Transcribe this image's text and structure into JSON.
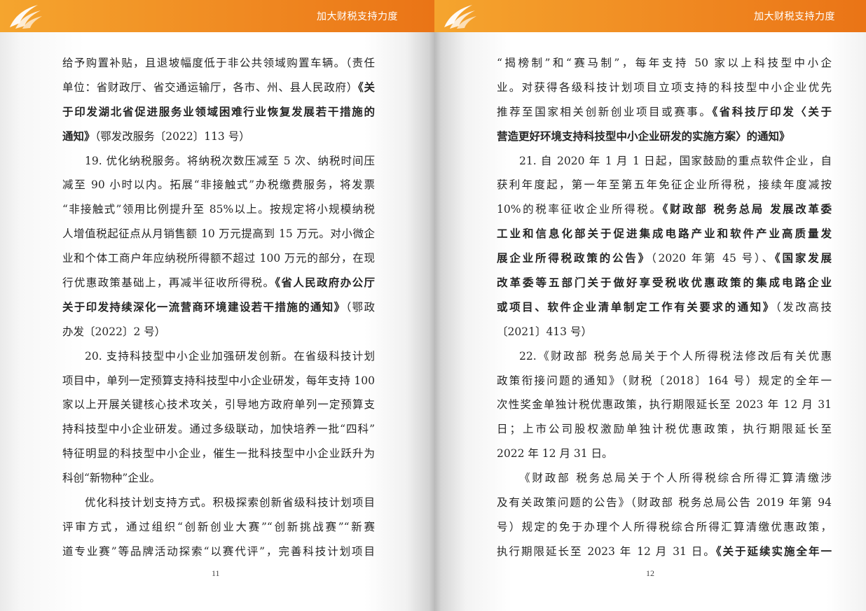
{
  "header": {
    "title": "加大财税支持力度"
  },
  "icons": {
    "logo": "stylized-wing-logo-icon"
  },
  "colors": {
    "band_start": "#f5a52e",
    "band_end": "#ea7416",
    "text": "#262626"
  },
  "left_page": {
    "page_number": "11",
    "lines": [
      {
        "segs": [
          {
            "t": "给予购置补贴，且退坡幅度低于非公共领域购置车辆。（责任"
          }
        ]
      },
      {
        "segs": [
          {
            "t": "单位：省财政厅、省交通运输厅，各市、州、县人民政府）"
          },
          {
            "t": "《关",
            "b": true
          }
        ]
      },
      {
        "segs": [
          {
            "t": "于印发湖北省促进服务业领域困难行业恢复发展若干措施的",
            "b": true
          }
        ]
      },
      {
        "last": true,
        "segs": [
          {
            "t": "通知》",
            "b": true
          },
          {
            "t": "（鄂发改服务〔2022〕113 号）"
          }
        ]
      },
      {
        "ind": true,
        "segs": [
          {
            "t": "19. 优化纳税服务。将纳税次数压减至 5 次、纳税时间压"
          }
        ]
      },
      {
        "segs": [
          {
            "t": "减至 90 小时以内。拓展“非接触式”办税缴费服务，将发票"
          }
        ]
      },
      {
        "segs": [
          {
            "t": "“非接触式”领用比例提升至 85%以上。按规定将小规模纳税"
          }
        ]
      },
      {
        "segs": [
          {
            "t": "人增值税起征点从月销售额 10 万元提高到 15 万元。对小微企"
          }
        ]
      },
      {
        "segs": [
          {
            "t": "业和个体工商户年应纳税所得额不超过 100 万元的部分，在现"
          }
        ]
      },
      {
        "segs": [
          {
            "t": "行优惠政策基础上，再减半征收所得税。"
          },
          {
            "t": "《省人民政府办公厅",
            "b": true
          }
        ]
      },
      {
        "segs": [
          {
            "t": "关于印发持续深化一流营商环境建设若干措施的通知》",
            "b": true
          },
          {
            "t": "（鄂政"
          }
        ]
      },
      {
        "last": true,
        "segs": [
          {
            "t": "办发〔2022〕2 号）"
          }
        ]
      },
      {
        "ind": true,
        "segs": [
          {
            "t": "20. 支持科技型中小企业加强研发创新。在省级科技计划"
          }
        ]
      },
      {
        "segs": [
          {
            "t": "项目中，单列一定预算支持科技型中小企业研发，每年支持 100"
          }
        ]
      },
      {
        "segs": [
          {
            "t": "家以上开展关键核心技术攻关，引导地方政府单列一定预算支"
          }
        ]
      },
      {
        "segs": [
          {
            "t": "持科技型中小企业研发。通过多级联动，加快培养一批“四科”"
          }
        ]
      },
      {
        "segs": [
          {
            "t": "特征明显的科技型中小企业，催生一批科技型中小企业跃升为"
          }
        ]
      },
      {
        "last": true,
        "segs": [
          {
            "t": "科创“新物种”企业。"
          }
        ]
      },
      {
        "ind": true,
        "segs": [
          {
            "t": "优化科技计划支持方式。积极探索创新省级科技计划项目"
          }
        ]
      },
      {
        "segs": [
          {
            "t": "评审方式，通过组织“创新创业大赛”“创新挑战赛”“新赛"
          }
        ]
      },
      {
        "segs": [
          {
            "t": "道专业赛”等品牌活动探索“以赛代评”，完善科技计划项目"
          }
        ]
      }
    ]
  },
  "right_page": {
    "page_number": "12",
    "lines": [
      {
        "segs": [
          {
            "t": "“揭榜制”和“赛马制”，每年支持 50 家以上科技型中小企"
          }
        ]
      },
      {
        "segs": [
          {
            "t": "业。对获得各级科技计划项目立项支持的科技型中小企业优先"
          }
        ]
      },
      {
        "segs": [
          {
            "t": "推荐至国家相关创新创业项目或赛事。"
          },
          {
            "t": "《省科技厅印发〈关于",
            "b": true
          }
        ]
      },
      {
        "last": true,
        "segs": [
          {
            "t": "营造更好环境支持科技型中小企业研发的实施方案〉的通知》",
            "b": true
          }
        ]
      },
      {
        "ind": true,
        "segs": [
          {
            "t": "21. 自 2020 年 1 月 1 日起，国家鼓励的重点软件企业，自"
          }
        ]
      },
      {
        "segs": [
          {
            "t": "获利年度起，第一年至第五年免征企业所得税，接续年度减按"
          }
        ]
      },
      {
        "segs": [
          {
            "t": "10%的税率征收企业所得税。"
          },
          {
            "t": "《财政部 税务总局 发展改革委",
            "b": true
          }
        ]
      },
      {
        "segs": [
          {
            "t": "工业和信息化部关于促进集成电路产业和软件产业高质量发",
            "b": true
          }
        ]
      },
      {
        "segs": [
          {
            "t": "展企业所得税政策的公告》",
            "b": true
          },
          {
            "t": "（2020 年第 45 号）、"
          },
          {
            "t": "《国家发展",
            "b": true
          }
        ]
      },
      {
        "segs": [
          {
            "t": "改革委等五部门关于做好享受税收优惠政策的集成电路企业",
            "b": true
          }
        ]
      },
      {
        "segs": [
          {
            "t": "或项目、软件企业清单制定工作有关要求的通知》",
            "b": true
          },
          {
            "t": "（发改高技"
          }
        ]
      },
      {
        "last": true,
        "segs": [
          {
            "t": "〔2021〕413 号）"
          }
        ]
      },
      {
        "ind": true,
        "segs": [
          {
            "t": "22.《财政部 税务总局关于个人所得税法修改后有关优惠"
          }
        ]
      },
      {
        "segs": [
          {
            "t": "政策衔接问题的通知》（财税〔2018〕164 号）规定的全年一"
          }
        ]
      },
      {
        "segs": [
          {
            "t": "次性奖金单独计税优惠政策，执行期限延长至 2023 年 12 月 31"
          }
        ]
      },
      {
        "segs": [
          {
            "t": "日；上市公司股权激励单独计税优惠政策，执行期限延长至"
          }
        ]
      },
      {
        "last": true,
        "segs": [
          {
            "t": "2022 年 12 月 31 日。"
          }
        ]
      },
      {
        "ind": true,
        "segs": [
          {
            "t": "《财政部 税务总局关于个人所得税综合所得汇算清缴涉"
          }
        ]
      },
      {
        "segs": [
          {
            "t": "及有关政策问题的公告》（财政部 税务总局公告 2019 年第 94"
          }
        ]
      },
      {
        "segs": [
          {
            "t": "号）规定的免于办理个人所得税综合所得汇算清缴优惠政策，"
          }
        ]
      },
      {
        "segs": [
          {
            "t": "执行期限延长至 2023 年 12 月 31 日。"
          },
          {
            "t": "《关于延续实施全年一",
            "b": true
          }
        ]
      }
    ]
  }
}
